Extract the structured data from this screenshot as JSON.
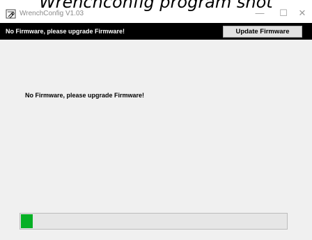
{
  "overlay": {
    "caption": "Wrenchconfig program shot"
  },
  "window": {
    "title": "WrenchConfig V1.03",
    "controls": {
      "minimize": "—",
      "maximize": "☐",
      "close": "✕"
    }
  },
  "topbar": {
    "message": "No Firmware, please upgrade Firmware!",
    "update_button_label": "Update Firmware"
  },
  "main": {
    "status_message": "No Firmware, please upgrade Firmware!"
  },
  "progress": {
    "value_percent": 4.5,
    "fill_color": "#06b025"
  },
  "colors": {
    "topbar_bg": "#000000",
    "window_bg": "#f0f0f0"
  }
}
